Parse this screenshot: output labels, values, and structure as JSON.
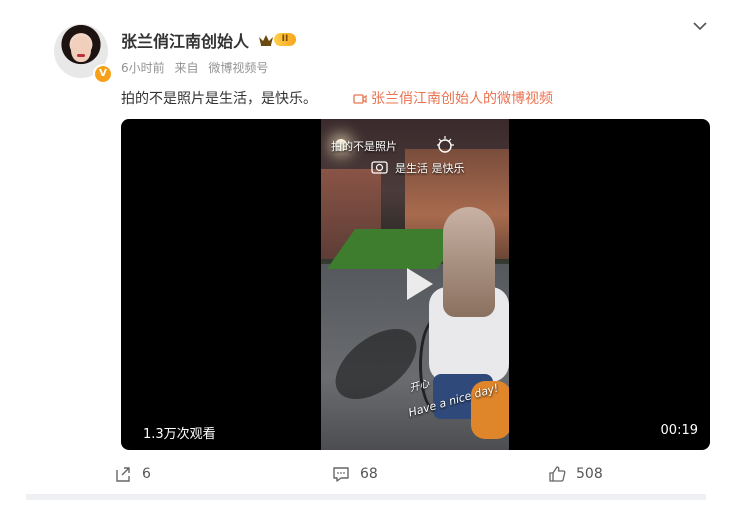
{
  "post": {
    "author": "张兰俏江南创始人",
    "level_badge": "II",
    "verified_mark": "V",
    "meta": {
      "time": "6小时前",
      "source_prefix": "来自",
      "source": "微博视频号"
    },
    "text": "拍的不是照片是生活，是快乐。",
    "video_link": "张兰俏江南创始人的微博视频"
  },
  "video": {
    "overlay_line1": "拍的不是照片",
    "overlay_line2": "是生活 是快乐",
    "handwriting_1": "开心",
    "handwriting_2": "Have a nice day!",
    "views": "1.3万次观看",
    "duration": "00:19"
  },
  "actions": {
    "repost_count": "6",
    "comment_count": "68",
    "like_count": "508"
  },
  "icons": {
    "menu": "chevron-down-icon",
    "crown": "crown-icon",
    "video_link": "video-icon",
    "play": "play-icon",
    "repost": "share-icon",
    "comment": "comment-icon",
    "like": "thumbs-up-icon"
  },
  "colors": {
    "link": "#eb7350",
    "badge_gold": "#f6a51c",
    "text": "#333333",
    "meta": "#939393"
  }
}
